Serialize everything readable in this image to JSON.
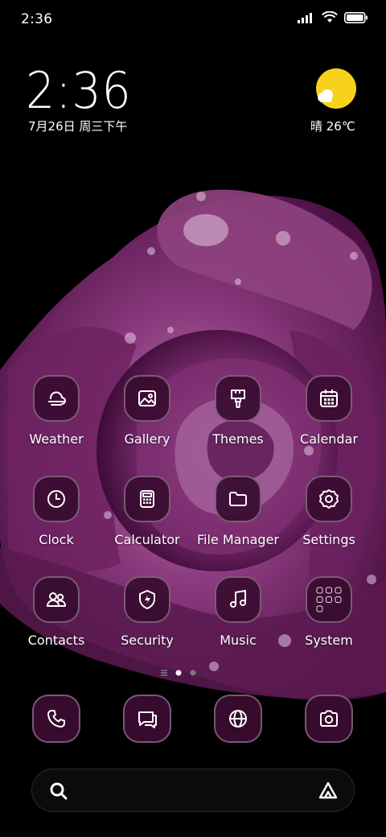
{
  "status_bar": {
    "time": "2:36",
    "icons": [
      "signal-icon",
      "wifi-icon",
      "battery-icon"
    ]
  },
  "clock_widget": {
    "time": "2:36",
    "date": "7月26日 周三下午"
  },
  "weather_widget": {
    "icon": "sun-cloud-icon",
    "text": "晴 26℃",
    "sun_color": "#f7d21b"
  },
  "apps": [
    {
      "label": "Weather",
      "icon": "weather-icon"
    },
    {
      "label": "Gallery",
      "icon": "gallery-icon"
    },
    {
      "label": "Themes",
      "icon": "themes-brush-icon"
    },
    {
      "label": "Calendar",
      "icon": "calendar-icon"
    },
    {
      "label": "Clock",
      "icon": "clock-icon"
    },
    {
      "label": "Calculator",
      "icon": "calculator-icon"
    },
    {
      "label": "File Manager",
      "icon": "folder-icon"
    },
    {
      "label": "Settings",
      "icon": "gear-icon"
    },
    {
      "label": "Contacts",
      "icon": "contacts-icon"
    },
    {
      "label": "Security",
      "icon": "shield-bolt-icon"
    },
    {
      "label": "Music",
      "icon": "music-note-icon"
    },
    {
      "label": "System",
      "icon": "folder-grid-icon"
    }
  ],
  "page_indicator": {
    "pages": 2,
    "current": 1
  },
  "dock": [
    {
      "icon": "phone-icon"
    },
    {
      "icon": "messages-icon"
    },
    {
      "icon": "browser-globe-icon"
    },
    {
      "icon": "camera-icon"
    }
  ],
  "search_bar": {
    "icon": "search-icon",
    "assistant_icon": "assistant-icon"
  },
  "colors": {
    "tile_background": "#3a0c30",
    "wallpaper_petal": "#7a2a6e",
    "background": "#000000"
  }
}
